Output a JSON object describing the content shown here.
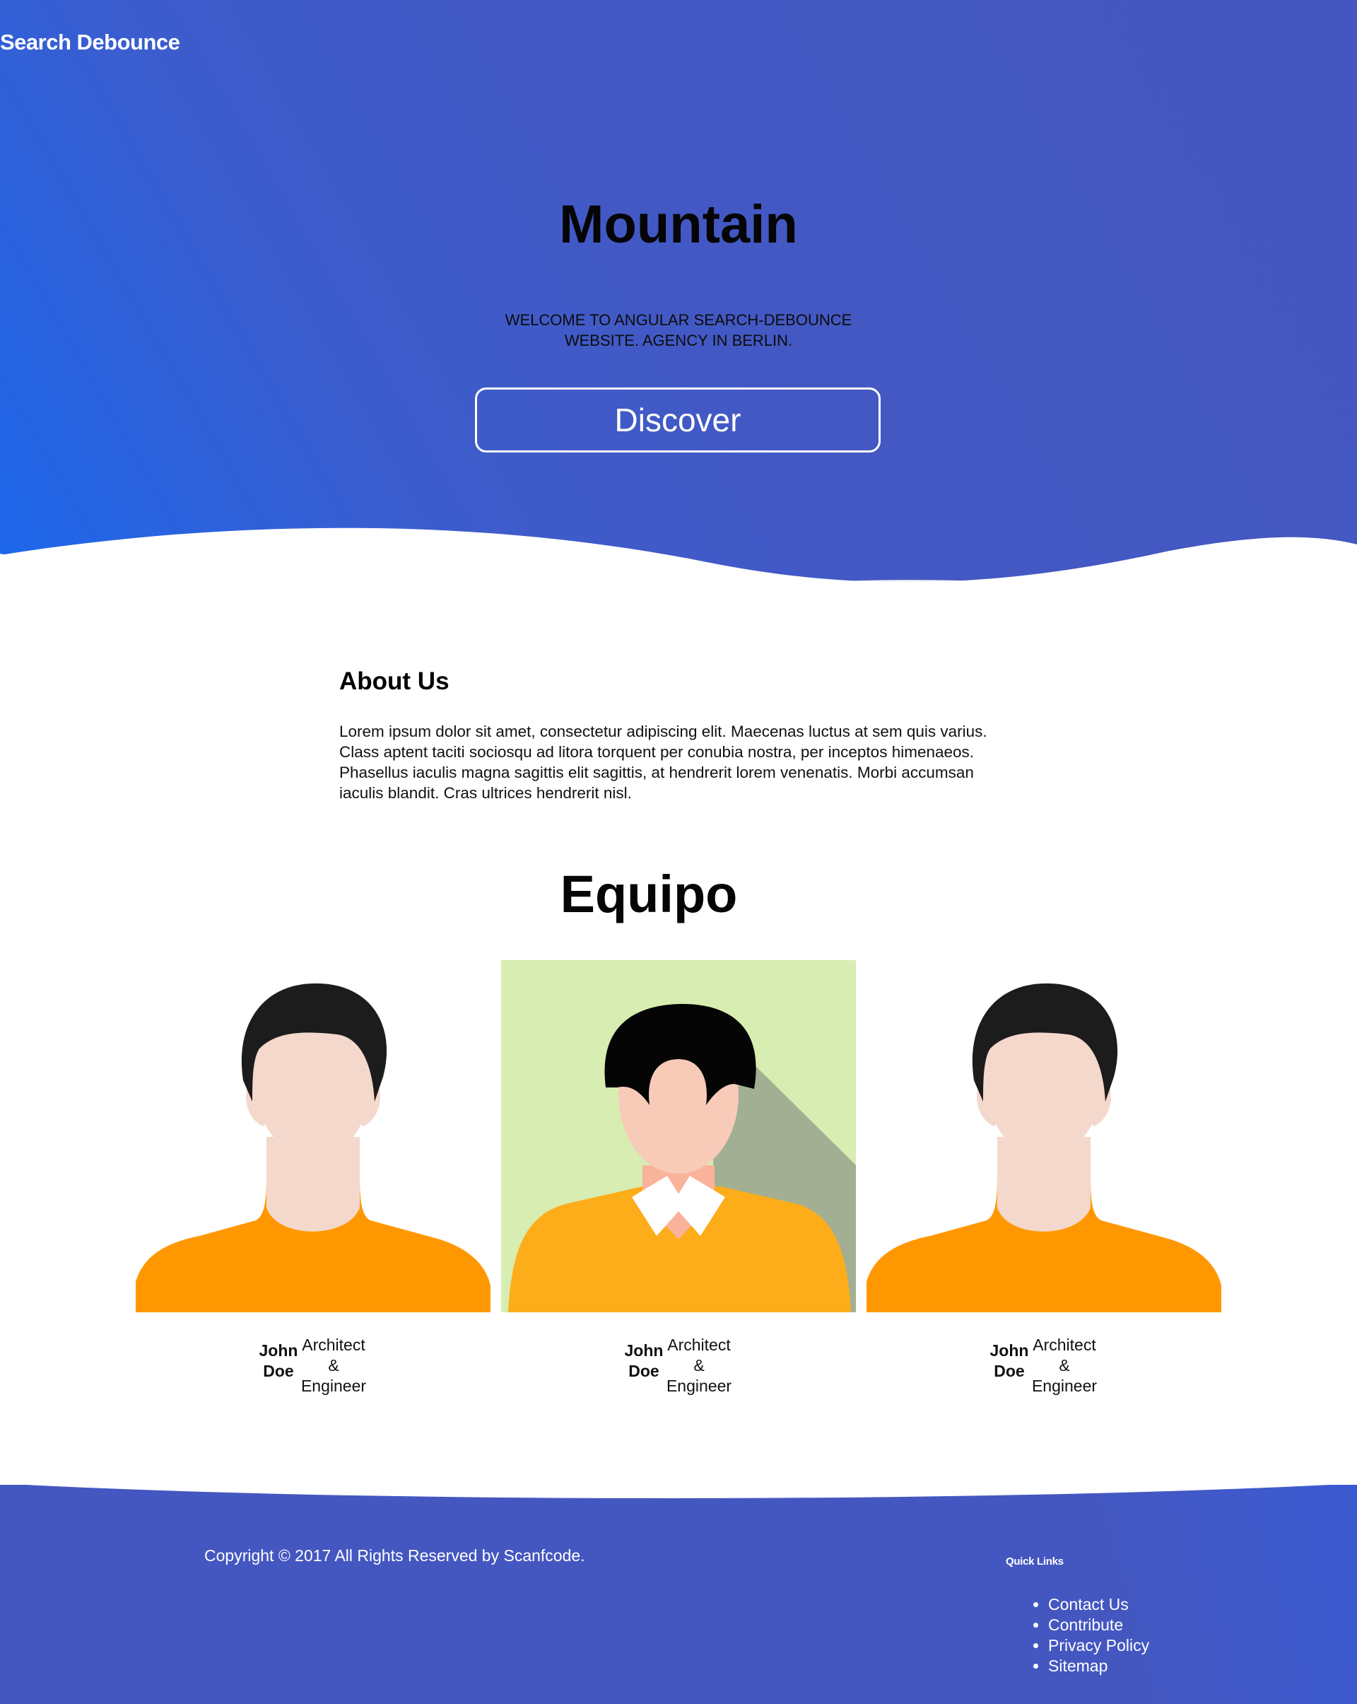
{
  "colors": {
    "hero_gradient_start": "#1a68ee",
    "hero_gradient_end": "#4457c0",
    "footer_background": "#4457c0",
    "wave_light": "#f5f5f5"
  },
  "header": {
    "brand": "Search Debounce"
  },
  "hero": {
    "title": "Mountain",
    "subtitle": "WELCOME TO ANGULAR SEARCH-DEBOUNCE WEBSITE. AGENCY IN BERLIN.",
    "button_label": "Discover"
  },
  "about": {
    "title": "About Us",
    "paragraphs": [
      "Lorem ipsum dolor sit amet, consectetur adipiscing elit. Maecenas luctus at sem quis varius.",
      "Class aptent taciti sociosqu ad litora torquent per conubia nostra, per inceptos himenaeos. Phasellus iaculis magna sagittis elit sagittis, at hendrerit lorem venenatis. Morbi accumsan iaculis blandit. Cras ultrices hendrerit nisl."
    ]
  },
  "team": {
    "title": "Equipo",
    "members": [
      {
        "name_first": "John",
        "name_last": "Doe",
        "role_line1": "Architect",
        "role_line2": "&",
        "role_line3": "Engineer",
        "avatar_icon": "male-avatar-icon"
      },
      {
        "name_first": "John",
        "name_last": "Doe",
        "role_line1": "Architect",
        "role_line2": "&",
        "role_line3": "Engineer",
        "avatar_icon": "male-avatar-green-background-icon"
      },
      {
        "name_first": "John",
        "name_last": "Doe",
        "role_line1": "Architect",
        "role_line2": "&",
        "role_line3": "Engineer",
        "avatar_icon": "male-avatar-icon"
      }
    ]
  },
  "footer": {
    "copyright": "Copyright © 2017 All Rights Reserved by Scanfcode.",
    "quick_links_title": "Quick Links",
    "quick_links": [
      "Contact Us",
      "Contribute",
      "Privacy Policy",
      "Sitemap"
    ]
  }
}
